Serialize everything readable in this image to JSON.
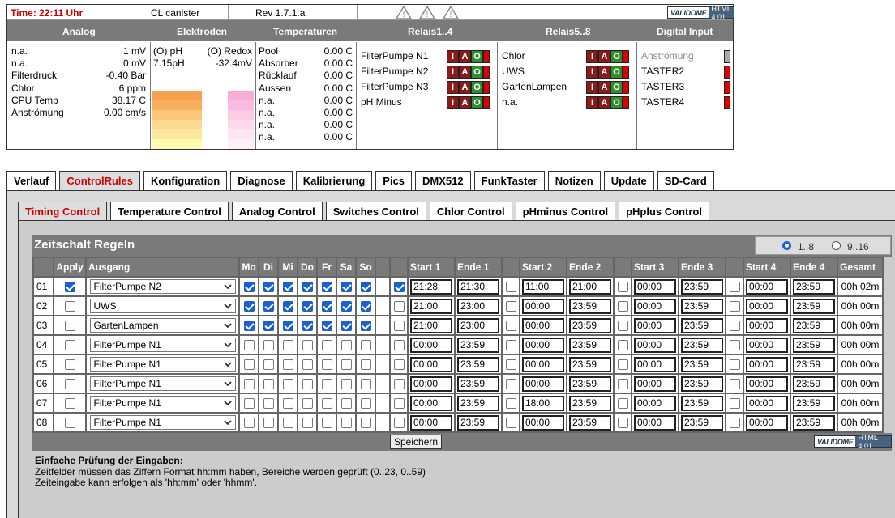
{
  "top": {
    "time": "Time: 22:11 Uhr",
    "device": "CL canister",
    "rev": "Rev 1.7.1.a",
    "validator": {
      "v": "VALIDOME",
      "h": "HTML 4.01"
    }
  },
  "headers": [
    "Analog",
    "Elektroden",
    "Temperaturen",
    "Relais1..4",
    "Relais5..8",
    "Digital Input"
  ],
  "analog": [
    [
      "n.a.",
      "1 mV"
    ],
    [
      "n.a.",
      "0 mV"
    ],
    [
      "Filterdruck",
      "-0.40 Bar"
    ],
    [
      "Chlor",
      "6 ppm"
    ],
    [
      "CPU Temp",
      "38.17 C"
    ],
    [
      "Anströmung",
      "0.00 cm/s"
    ]
  ],
  "elektroden": {
    "ph_label": "(O) pH",
    "redox_label": "(O) Redox",
    "ph_value": "7.15pH",
    "redox_value": "-32.4mV",
    "ph_level": 0.8,
    "redox_level": 0.75
  },
  "temps": [
    [
      "Pool",
      "0.00 C"
    ],
    [
      "Absorber",
      "0.00 C"
    ],
    [
      "Rücklauf",
      "0.00 C"
    ],
    [
      "Aussen",
      "0.00 C"
    ],
    [
      "n.a.",
      "0.00 C"
    ],
    [
      "n.a.",
      "0.00 C"
    ],
    [
      "n.a.",
      "0.00 C"
    ],
    [
      "n.a.",
      "0.00 C"
    ]
  ],
  "relais1": [
    "FilterPumpe N1",
    "FilterPumpe N2",
    "FilterPumpe N3",
    "pH Minus"
  ],
  "relais2": [
    "Chlor",
    "UWS",
    "GartenLampen",
    "n.a."
  ],
  "relay_letters": [
    "I",
    "A",
    "O"
  ],
  "digital": [
    "Anströmung",
    "TASTER2",
    "TASTER3",
    "TASTER4"
  ],
  "tabs_main": [
    "Verlauf",
    "ControlRules",
    "Konfiguration",
    "Diagnose",
    "Kalibrierung",
    "Pics",
    "DMX512",
    "FunkTaster",
    "Notizen",
    "Update",
    "SD-Card"
  ],
  "tabs_sub": [
    "Timing Control",
    "Temperature Control",
    "Analog Control",
    "Switches Control",
    "Chlor Control",
    "pHminus Control",
    "pHplus Control"
  ],
  "zeitschalt": {
    "title": "Zeitschalt Regeln",
    "range1": "1..8",
    "range2": "9..16"
  },
  "columns": {
    "apply": "Apply",
    "ausgang": "Ausgang",
    "days": [
      "Mo",
      "Di",
      "Mi",
      "Do",
      "Fr",
      "Sa",
      "So"
    ],
    "start": [
      "Start 1",
      "Start 2",
      "Start 3",
      "Start 4"
    ],
    "ende": [
      "Ende 1",
      "Ende 2",
      "Ende 3",
      "Ende 4"
    ],
    "gesamt": "Gesamt"
  },
  "rows": [
    {
      "n": "01",
      "apply": true,
      "out": "FilterPumpe N2",
      "days": [
        1,
        1,
        1,
        1,
        1,
        1,
        1
      ],
      "en": [
        1,
        0,
        0,
        0
      ],
      "s": [
        "21:28",
        "11:00",
        "00:00",
        "00:00"
      ],
      "e": [
        "21:30",
        "21:00",
        "23:59",
        "23:59"
      ],
      "g": "00h 02m"
    },
    {
      "n": "02",
      "apply": false,
      "out": "UWS",
      "days": [
        1,
        1,
        1,
        1,
        1,
        1,
        1
      ],
      "en": [
        0,
        0,
        0,
        0
      ],
      "s": [
        "21:00",
        "00:00",
        "00:00",
        "00:00"
      ],
      "e": [
        "23:00",
        "23:59",
        "23:59",
        "23:59"
      ],
      "g": "00h 00m"
    },
    {
      "n": "03",
      "apply": false,
      "out": "GartenLampen",
      "days": [
        1,
        1,
        1,
        1,
        1,
        1,
        1
      ],
      "en": [
        0,
        0,
        0,
        0
      ],
      "s": [
        "21:00",
        "00:00",
        "00:00",
        "00:00"
      ],
      "e": [
        "23:00",
        "23:59",
        "23:59",
        "23:59"
      ],
      "g": "00h 00m"
    },
    {
      "n": "04",
      "apply": false,
      "out": "FilterPumpe N1",
      "days": [
        0,
        0,
        0,
        0,
        0,
        0,
        0
      ],
      "en": [
        0,
        0,
        0,
        0
      ],
      "s": [
        "00:00",
        "00:00",
        "00:00",
        "00:00"
      ],
      "e": [
        "23:59",
        "23:59",
        "23:59",
        "23:59"
      ],
      "g": "00h 00m"
    },
    {
      "n": "05",
      "apply": false,
      "out": "FilterPumpe N1",
      "days": [
        0,
        0,
        0,
        0,
        0,
        0,
        0
      ],
      "en": [
        0,
        0,
        0,
        0
      ],
      "s": [
        "00:00",
        "00:00",
        "00:00",
        "00:00"
      ],
      "e": [
        "23:59",
        "23:59",
        "23:59",
        "23:59"
      ],
      "g": "00h 00m"
    },
    {
      "n": "06",
      "apply": false,
      "out": "FilterPumpe N1",
      "days": [
        0,
        0,
        0,
        0,
        0,
        0,
        0
      ],
      "en": [
        0,
        0,
        0,
        0
      ],
      "s": [
        "00:00",
        "00:00",
        "00:00",
        "00:00"
      ],
      "e": [
        "23:59",
        "23:59",
        "23:59",
        "23:59"
      ],
      "g": "00h 00m"
    },
    {
      "n": "07",
      "apply": false,
      "out": "FilterPumpe N1",
      "days": [
        0,
        0,
        0,
        0,
        0,
        0,
        0
      ],
      "en": [
        0,
        0,
        0,
        0
      ],
      "s": [
        "00:00",
        "18:00",
        "00:00",
        "00:00"
      ],
      "e": [
        "23:59",
        "23:59",
        "23:59",
        "23:59"
      ],
      "g": "00h 00m"
    },
    {
      "n": "08",
      "apply": false,
      "out": "FilterPumpe N1",
      "days": [
        0,
        0,
        0,
        0,
        0,
        0,
        0
      ],
      "en": [
        0,
        0,
        0,
        0
      ],
      "s": [
        "00:00",
        "00:00",
        "00:00",
        "00:00"
      ],
      "e": [
        "23:59",
        "23:59",
        "23:59",
        "23:59"
      ],
      "g": "00h 00m"
    }
  ],
  "save": "Speichern",
  "info": {
    "title": "Einfache Prüfung der Eingaben:",
    "line1": "Zeitfelder müssen das Ziffern Format hh:mm haben, Bereiche werden geprüft (0..23, 0..59)",
    "line2": "Zeiteingabe kann erfolgen als 'hh:mm' oder 'hhmm'."
  },
  "colors": {
    "time": "#cc0000",
    "header": "#7a7a7a",
    "active_tab": "#cc0000",
    "relay_green": "#2d8f2d",
    "relay_red": "#8b1b1b",
    "check": "#1a5fd6"
  }
}
